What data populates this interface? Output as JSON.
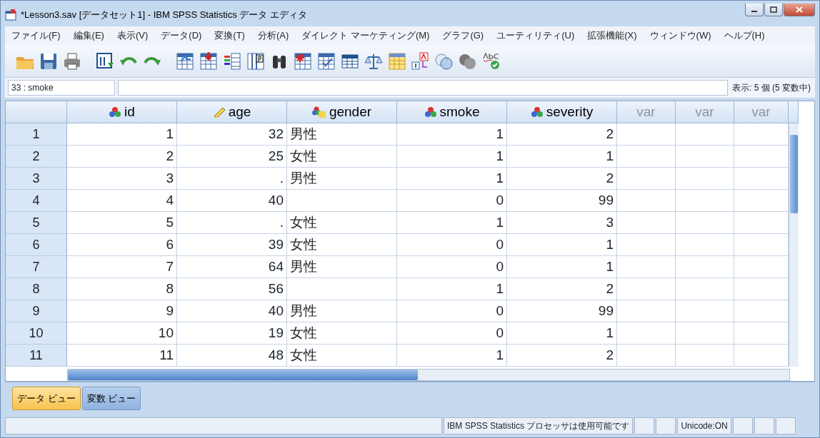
{
  "window": {
    "title": "*Lesson3.sav [データセット1] - IBM SPSS Statistics データ エディタ"
  },
  "menu": [
    "ファイル(F)",
    "編集(E)",
    "表示(V)",
    "データ(D)",
    "変換(T)",
    "分析(A)",
    "ダイレクト マーケティング(M)",
    "グラフ(G)",
    "ユーティリティ(U)",
    "拡張機能(X)",
    "ウィンドウ(W)",
    "ヘルプ(H)"
  ],
  "cell_editor": {
    "cell": "33 : smoke",
    "visible_count": "表示: 5 個 (5 変数中)"
  },
  "table": {
    "columns": [
      {
        "label": "id",
        "kind": "nominal"
      },
      {
        "label": "age",
        "kind": "scale"
      },
      {
        "label": "gender",
        "kind": "string"
      },
      {
        "label": "smoke",
        "kind": "nominal"
      },
      {
        "label": "severity",
        "kind": "nominal"
      },
      {
        "label": "var",
        "kind": "empty"
      },
      {
        "label": "var",
        "kind": "empty"
      },
      {
        "label": "var",
        "kind": "empty"
      }
    ],
    "rows": [
      {
        "number": "1",
        "cells": [
          "1",
          "32",
          "男性",
          "1",
          "2"
        ]
      },
      {
        "number": "2",
        "cells": [
          "2",
          "25",
          "女性",
          "1",
          "1"
        ]
      },
      {
        "number": "3",
        "cells": [
          "3",
          ".",
          "男性",
          "1",
          "2"
        ]
      },
      {
        "number": "4",
        "cells": [
          "4",
          "40",
          null,
          "0",
          "99"
        ]
      },
      {
        "number": "5",
        "cells": [
          "5",
          ".",
          "女性",
          "1",
          "3"
        ]
      },
      {
        "number": "6",
        "cells": [
          "6",
          "39",
          "女性",
          "0",
          "1"
        ]
      },
      {
        "number": "7",
        "cells": [
          "7",
          "64",
          "男性",
          "0",
          "1"
        ]
      },
      {
        "number": "8",
        "cells": [
          "8",
          "56",
          null,
          "1",
          "2"
        ]
      },
      {
        "number": "9",
        "cells": [
          "9",
          "40",
          "男性",
          "0",
          "99"
        ]
      },
      {
        "number": "10",
        "cells": [
          "10",
          "19",
          "女性",
          "0",
          "1"
        ]
      },
      {
        "number": "11",
        "cells": [
          "11",
          "48",
          "女性",
          "1",
          "2"
        ]
      }
    ]
  },
  "tabs": [
    {
      "label": "データ ビュー",
      "selected": true
    },
    {
      "label": "変数 ビュー",
      "selected": false
    }
  ],
  "status_bar": [
    "IBM SPSS Statistics プロセッサは使用可能です",
    "Unicode:ON"
  ]
}
